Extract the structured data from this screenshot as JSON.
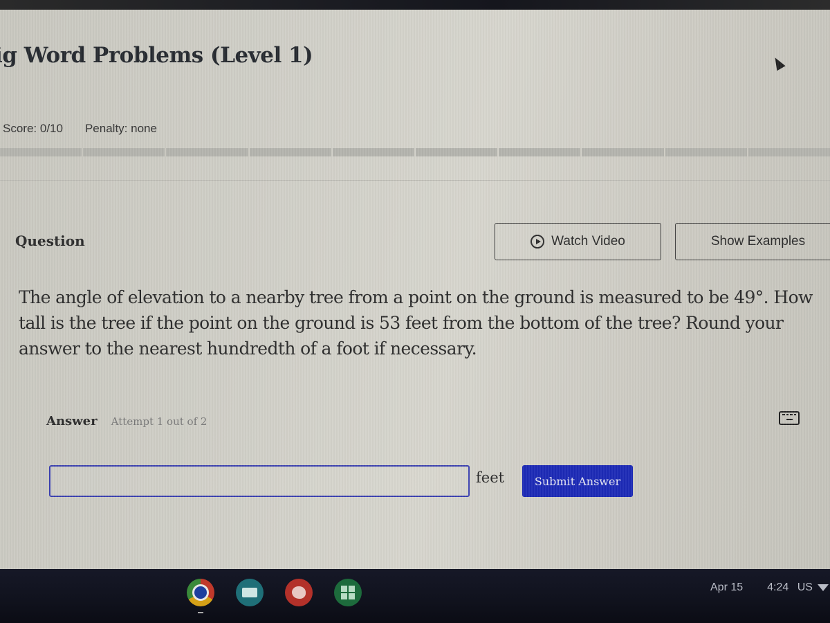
{
  "page": {
    "title": "ig Word Problems (Level 1)",
    "score_label": "Score:",
    "score_value": "0/10",
    "penalty_label": "Penalty:",
    "penalty_value": "none",
    "progress": {
      "completed": 0,
      "total": 10
    }
  },
  "question": {
    "heading": "Question",
    "watch_video_label": "Watch Video",
    "show_examples_label": "Show Examples",
    "text": "The angle of elevation to a nearby tree from a point on the ground is measured to be 49°. How tall is the tree if the point on the ground is 53 feet from the bottom of the tree? Round your answer to the nearest hundredth of a foot if necessary."
  },
  "answer": {
    "label": "Answer",
    "attempt": "Attempt 1 out of 2",
    "input_value": "",
    "unit": "feet",
    "submit_label": "Submit Answer",
    "accent_color": "#1c2ab6"
  },
  "shelf": {
    "apps": [
      {
        "name": "Chrome",
        "icon": "chrome-icon"
      },
      {
        "name": "Slides",
        "icon": "slides-icon"
      },
      {
        "name": "Paint",
        "icon": "paint-palette-icon"
      },
      {
        "name": "Calculator",
        "icon": "calculator-icon"
      }
    ],
    "date": "Apr 15",
    "time": "4:24",
    "locale": "US"
  }
}
